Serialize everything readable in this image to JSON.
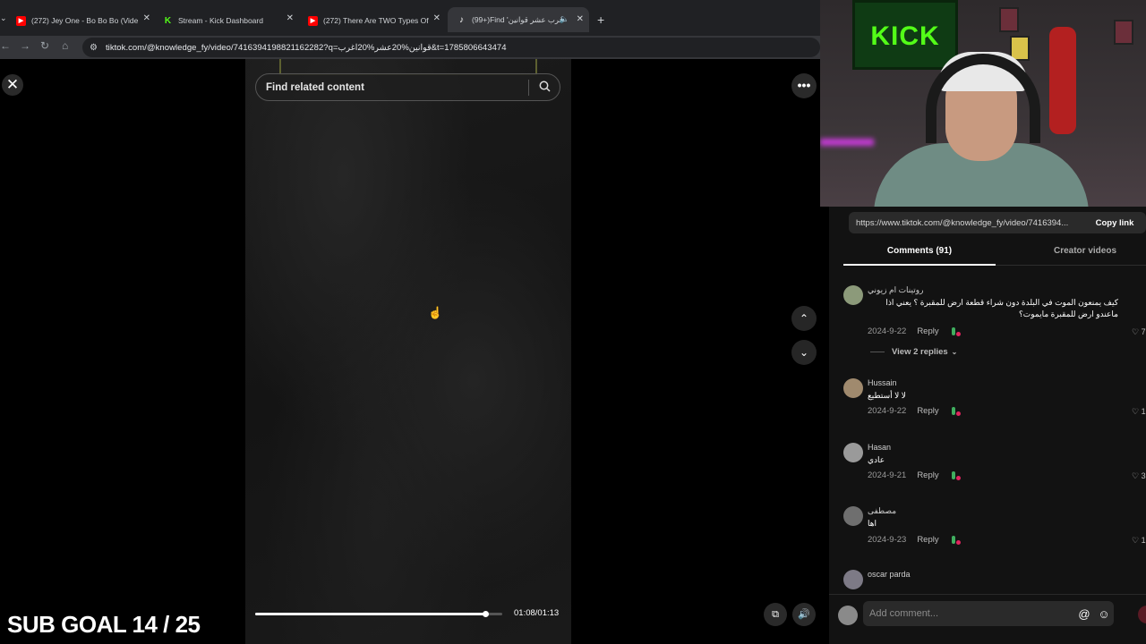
{
  "browser": {
    "tabs": [
      {
        "title": "(272) Jey One - Bo Bo Bo (Vide",
        "favicon": "youtube-icon"
      },
      {
        "title": "Stream - Kick Dashboard",
        "favicon": "kick-icon"
      },
      {
        "title": "(272) There Are TWO Types Of",
        "favicon": "youtube-icon"
      },
      {
        "title": "(99+)Find 'أغرب عشر قوانين",
        "favicon": "tiktok-icon"
      }
    ],
    "url": "tiktok.com/@knowledge_fy/video/7416394198821162282?q=قوانين%20عشر%20اغرب&t=1785806643474"
  },
  "video": {
    "search_placeholder": "Find related content",
    "time": "01:08/01:13",
    "progress": 0.93
  },
  "overlay": {
    "sub_goal": "SUB GOAL 14 / 25"
  },
  "webcam": {
    "sign_text": "KICK"
  },
  "panel": {
    "link": "https://www.tiktok.com/@knowledge_fy/video/7416394...",
    "copy_label": "Copy link",
    "tab_comments": "Comments (91)",
    "tab_creator": "Creator videos",
    "view_replies": "View 2 replies",
    "comments": [
      {
        "name": "روتينات ام زيوني",
        "text": "كيف يمنعون الموت في البلدة دون شراء قطعة ارض للمقبرة ؟ يعني اذا ماعندو ارض للمقبرة مايموت؟",
        "date": "2024-9-22",
        "reply": "Reply",
        "likes": "7"
      },
      {
        "name": "Hussain",
        "text": "لا لا أستطيع",
        "date": "2024-9-22",
        "reply": "Reply",
        "likes": "1"
      },
      {
        "name": "Hasan",
        "text": "عادي",
        "date": "2024-9-21",
        "reply": "Reply",
        "likes": "3"
      },
      {
        "name": "مصطفى",
        "text": "اها",
        "date": "2024-9-23",
        "reply": "Reply",
        "likes": "1"
      },
      {
        "name": "oscar parda",
        "text": "",
        "date": "",
        "reply": "",
        "likes": ""
      }
    ],
    "comment_placeholder": "Add comment..."
  },
  "colors": {
    "kick_green": "#53fc18",
    "tiktok_red": "#fe2c55"
  }
}
